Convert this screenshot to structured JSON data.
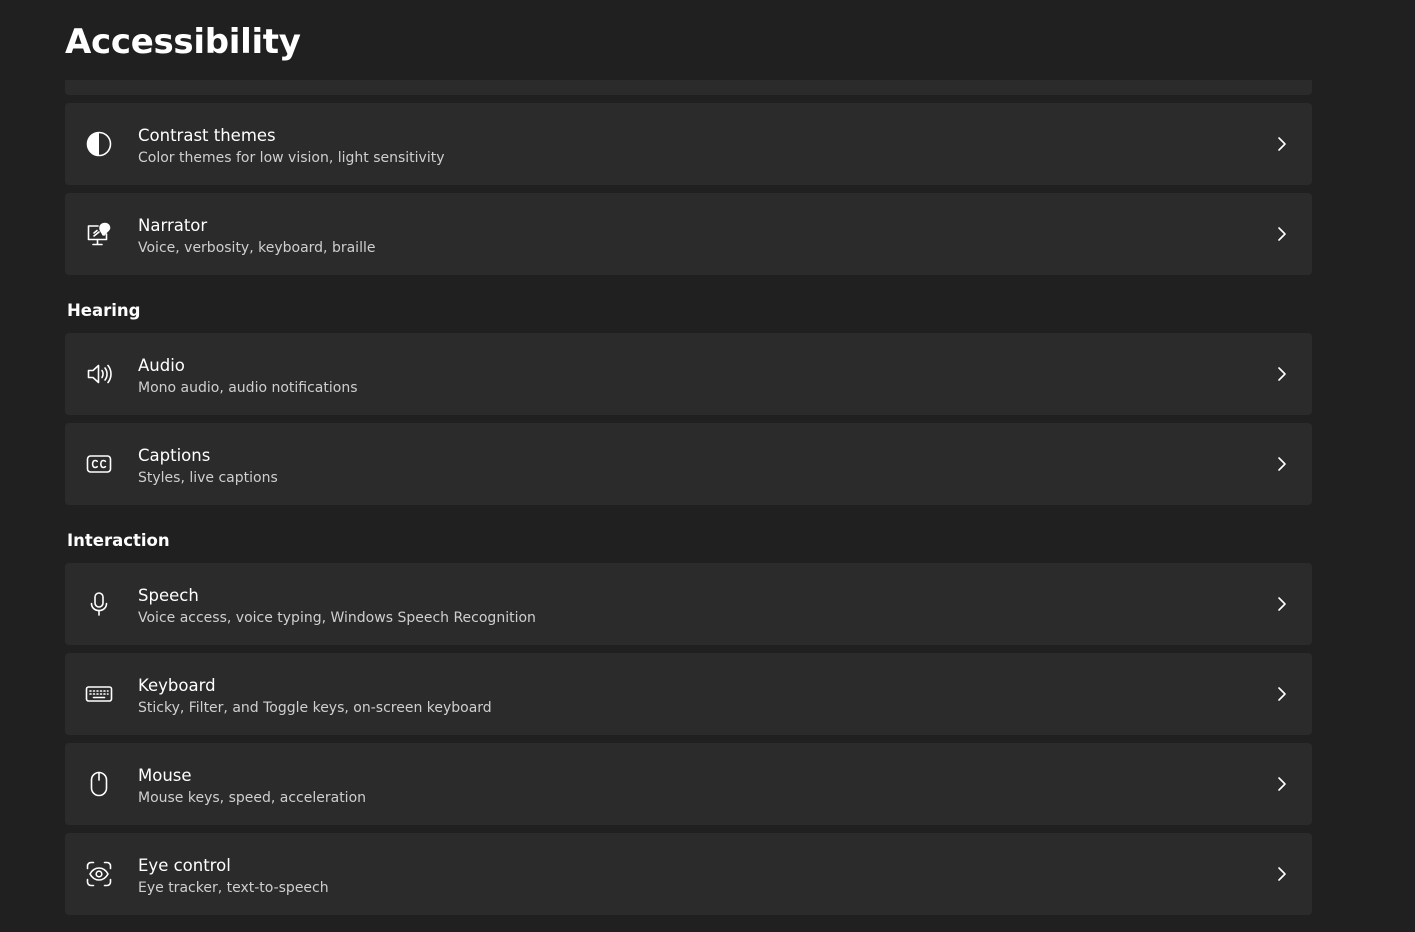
{
  "page": {
    "title": "Accessibility"
  },
  "sections": {
    "hearing": "Hearing",
    "interaction": "Interaction"
  },
  "items": [
    {
      "title": "Contrast themes",
      "subtitle": "Color themes for low vision, light sensitivity",
      "icon": "contrast-icon"
    },
    {
      "title": "Narrator",
      "subtitle": "Voice, verbosity, keyboard, braille",
      "icon": "narrator-icon"
    },
    {
      "title": "Audio",
      "subtitle": "Mono audio, audio notifications",
      "icon": "speaker-icon"
    },
    {
      "title": "Captions",
      "subtitle": "Styles, live captions",
      "icon": "closed-captions-icon"
    },
    {
      "title": "Speech",
      "subtitle": "Voice access, voice typing, Windows Speech Recognition",
      "icon": "microphone-icon"
    },
    {
      "title": "Keyboard",
      "subtitle": "Sticky, Filter, and Toggle keys, on-screen keyboard",
      "icon": "keyboard-icon"
    },
    {
      "title": "Mouse",
      "subtitle": "Mouse keys, speed, acceleration",
      "icon": "mouse-icon"
    },
    {
      "title": "Eye control",
      "subtitle": "Eye tracker, text-to-speech",
      "icon": "eye-control-icon"
    }
  ],
  "colors": {
    "background": "#202020",
    "card": "#2b2b2b",
    "text": "#ffffff",
    "subtext": "#cfcfcf"
  }
}
